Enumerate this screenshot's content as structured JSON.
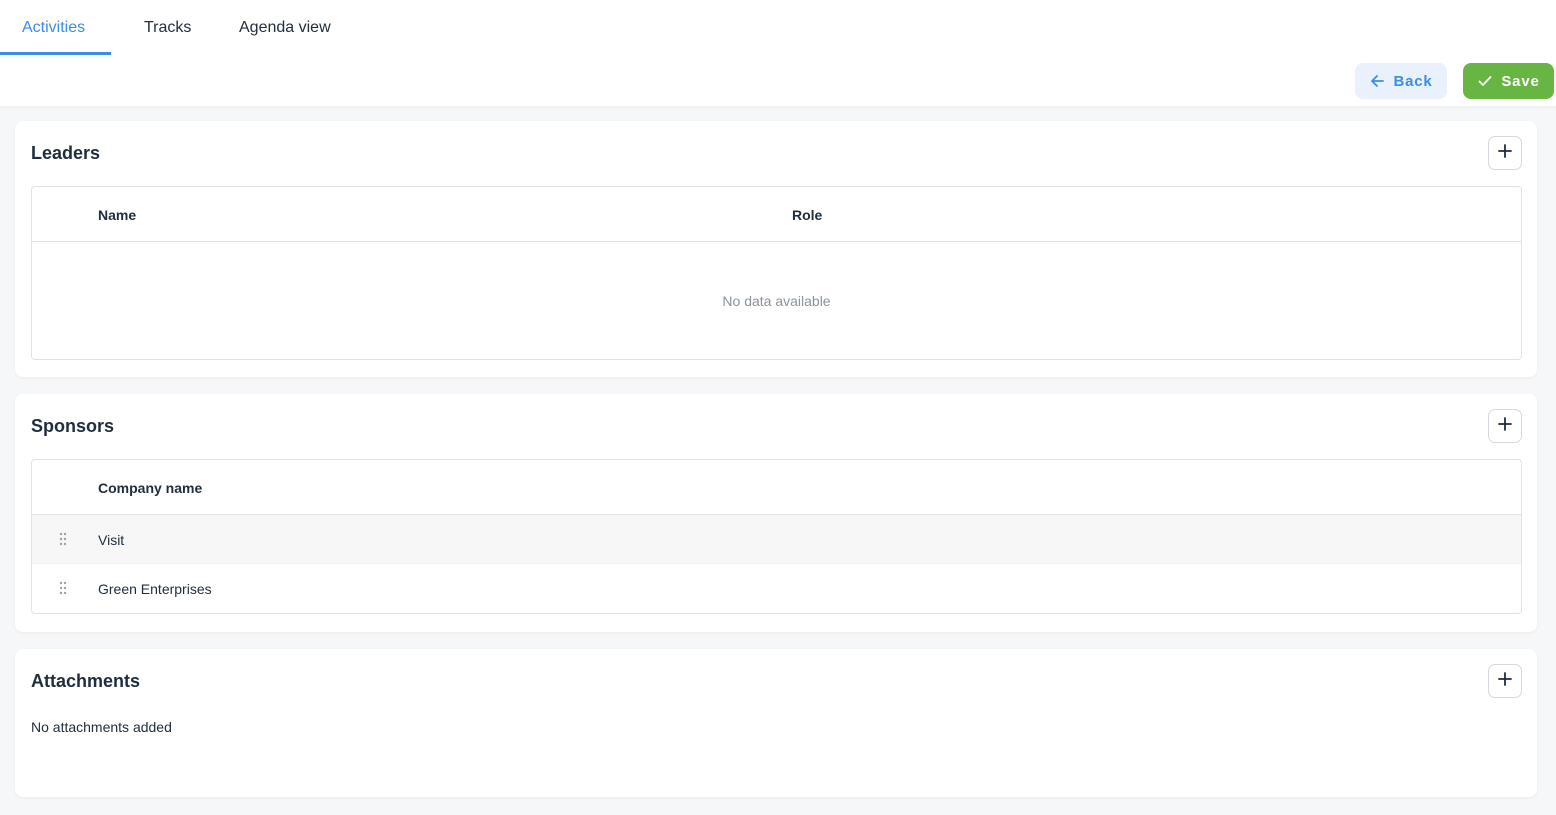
{
  "tabs": [
    {
      "label": "Activities",
      "active": true
    },
    {
      "label": "Tracks",
      "active": false
    },
    {
      "label": "Agenda view",
      "active": false
    }
  ],
  "actions": {
    "back_label": "Back",
    "save_label": "Save"
  },
  "leaders": {
    "title": "Leaders",
    "columns": [
      "Name",
      "Role"
    ],
    "empty_text": "No data available"
  },
  "sponsors": {
    "title": "Sponsors",
    "columns": [
      "Company name"
    ],
    "rows": [
      "Visit",
      "Green Enterprises"
    ]
  },
  "attachments": {
    "title": "Attachments",
    "empty_text": "No attachments added"
  },
  "colors": {
    "accent": "#3a8ee6",
    "save": "#67b644",
    "back_bg": "#e8f1fc"
  },
  "icons": {
    "back": "arrow-left-icon",
    "save": "check-icon",
    "add": "plus-icon",
    "drag": "drag-handle-icon"
  }
}
